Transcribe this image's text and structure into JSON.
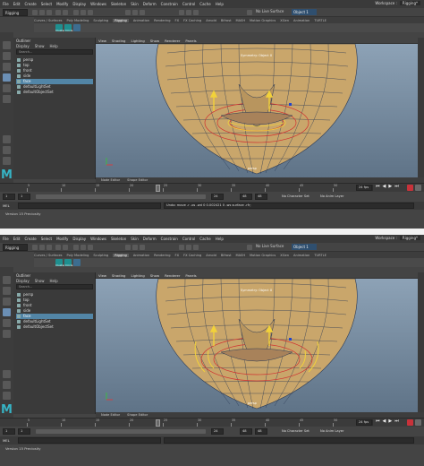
{
  "menu": [
    "File",
    "Edit",
    "Create",
    "Select",
    "Modify",
    "Display",
    "Windows",
    "Skeleton",
    "Skin",
    "Deform",
    "Constrain",
    "Control",
    "Cache",
    "Help"
  ],
  "window_controls": {
    "workspace_label": "Workspace :",
    "workspace_value": "Rigging*"
  },
  "status_bar": {
    "mode": "Rigging",
    "live_surface": "No Live Surface",
    "object_field": "Object 1"
  },
  "shelf_tabs": [
    "Curves / Surfaces",
    "Poly Modeling",
    "Sculpting",
    "Rigging",
    "Animation",
    "Rendering",
    "FX",
    "FX Caching",
    "Arnold",
    "Bifrost",
    "MASH",
    "Motion Graphics",
    "XGen",
    "Animation",
    "TURTLE"
  ],
  "shelf_icons": [
    {
      "label": "Cluster",
      "icon": "cluster-icon"
    },
    {
      "label": "Circle",
      "icon": "circle-icon"
    },
    {
      "label": "",
      "icon": "wire-icon"
    }
  ],
  "outliner": {
    "title": "Outliner",
    "menu": [
      "Display",
      "Show",
      "Help"
    ],
    "search_placeholder": "Search...",
    "items": [
      "persp",
      "top",
      "front",
      "side",
      "face",
      "defaultLightSet",
      "defaultObjectSet"
    ],
    "selected_index": 4
  },
  "panel_menu": [
    "View",
    "Shading",
    "Lighting",
    "Show",
    "Renderer",
    "Panels"
  ],
  "viewport": {
    "camera_label": "Symmetry: Object X",
    "camera_name": "persp"
  },
  "editor_tabs": [
    "Node Editor",
    "Shape Editor"
  ],
  "timeline": {
    "ticks": [
      "5",
      "10",
      "15",
      "20",
      "25",
      "30",
      "35",
      "40",
      "45",
      "50"
    ],
    "current_frame": "1",
    "end_frame": "1"
  },
  "range": {
    "start": "1",
    "playback_start": "1",
    "playback_end": "24",
    "end_a": "24",
    "end_b": "48",
    "end_c": "48",
    "character_set": "No Character Set",
    "anim_layer": "No Anim Layer",
    "fps": "24 fps"
  },
  "command_line": {
    "label": "MEL",
    "result_top": "Undo: move -r -os -wd 0 0.002421 0 -ws surface -rfr;",
    "result_bottom": ""
  },
  "help_line": "Version 15 Preciosity",
  "colors": {
    "accent": "#5285a6",
    "record_red": "#c8323a",
    "logo": "#36b3c4",
    "shelf_teal": "#1f8f8f"
  }
}
